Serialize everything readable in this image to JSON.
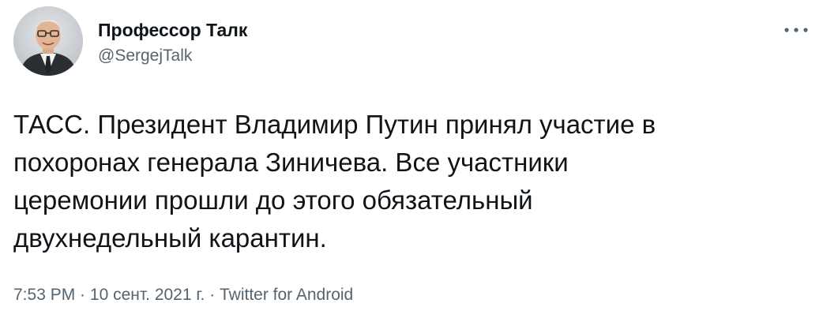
{
  "author": {
    "display_name": "Профессор Талк",
    "handle": "@SergejTalk",
    "avatar_icon": "person-avatar-photo"
  },
  "menu": {
    "icon": "more-horizontal-icon"
  },
  "tweet": {
    "text": "ТАСС. Президент Владимир Путин принял участие в\nпохоронах генерала Зиничева. Все участники\nцеремонии прошли до этого обязательный\nдвухнедельный карантин."
  },
  "meta": {
    "time": "7:53 PM",
    "separator1": " · ",
    "date": "10 сент. 2021 г.",
    "separator2": " · ",
    "source": "Twitter for Android"
  },
  "colors": {
    "text": "#0f1419",
    "secondary": "#536471",
    "background": "#ffffff"
  }
}
